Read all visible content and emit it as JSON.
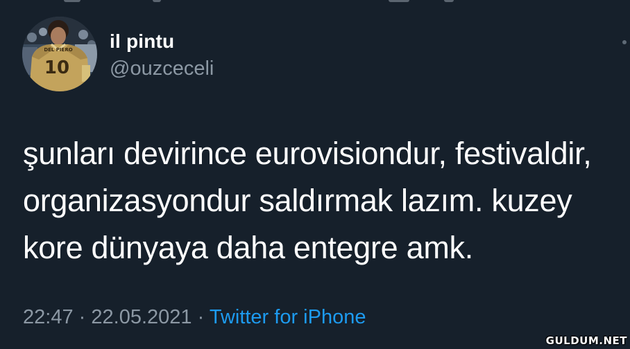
{
  "tweet": {
    "author": {
      "display_name": "il pintu",
      "handle": "@ouzceceli",
      "avatar_icon": "profile-photo-footballer-number-10",
      "jersey_number": "10",
      "jersey_name": "DEL PIERO"
    },
    "text_lines": [
      "şunları devirince eurovisiondur, festivaldir,",
      "organizasyondur saldırmak lazım. kuzey",
      "kore dünyaya daha entegre amk."
    ],
    "time": "22:47",
    "separator": "·",
    "date": "22.05.2021",
    "source": "Twitter for iPhone"
  },
  "watermark": "GULDUM.NET",
  "colors": {
    "background": "#16202b",
    "text": "#ffffff",
    "secondary_text": "#8c98a4",
    "link": "#1d9bf0"
  }
}
